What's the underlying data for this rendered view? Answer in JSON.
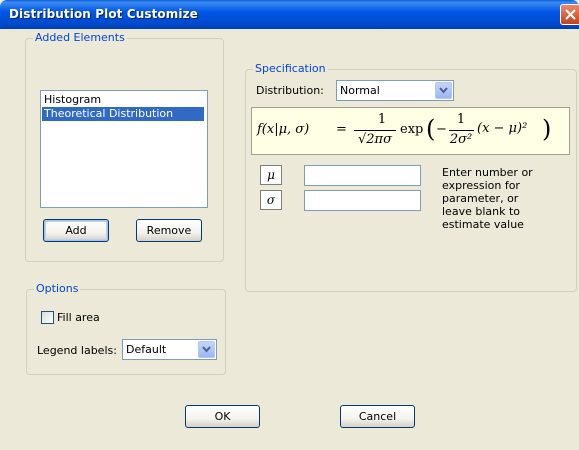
{
  "window": {
    "title": "Distribution Plot Customize"
  },
  "added_elements": {
    "legend": "Added Elements",
    "items": [
      "Histogram",
      "Theoretical Distribution"
    ],
    "selected_index": 1,
    "add_label": "Add",
    "remove_label": "Remove"
  },
  "specification": {
    "legend": "Specification",
    "distribution_label": "Distribution:",
    "distribution_value": "Normal",
    "formula": {
      "lhs": "f(x|μ, σ)",
      "eq": "=",
      "frac_num": "1",
      "frac_den": "√2πσ",
      "exp": "exp",
      "inner_num": "1",
      "inner_den": "2σ²",
      "inner_tail": "(x − μ)²"
    },
    "params": [
      {
        "symbol": "μ",
        "value": ""
      },
      {
        "symbol": "σ",
        "value": ""
      }
    ],
    "help_text": [
      "Enter number or",
      "expression for",
      "parameter, or",
      "leave blank to",
      "estimate value"
    ]
  },
  "options": {
    "legend": "Options",
    "fill_area_label": "Fill area",
    "fill_area_checked": false,
    "legend_labels_label": "Legend labels:",
    "legend_labels_value": "Default"
  },
  "footer": {
    "ok_label": "OK",
    "cancel_label": "Cancel"
  }
}
